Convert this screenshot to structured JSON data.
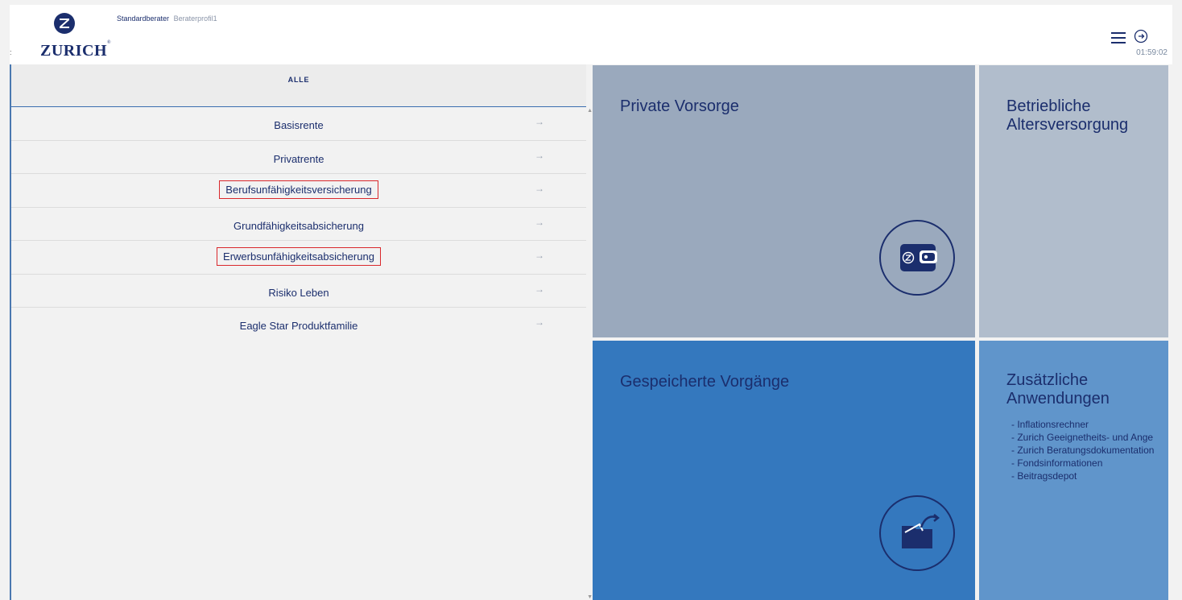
{
  "header": {
    "brand": "ZURICH",
    "role": "Standardberater",
    "profile": "Beraterprofil1",
    "timer": "01:59:02",
    "left_marker": ":"
  },
  "panel": {
    "title": "ALLE",
    "products": [
      {
        "label": "Basisrente",
        "highlighted": false
      },
      {
        "label": "Privatrente",
        "highlighted": false
      },
      {
        "label": "Berufsunfähigkeitsversicherung",
        "highlighted": true
      },
      {
        "label": "Grundfähigkeitsabsicherung",
        "highlighted": false
      },
      {
        "label": "Erwerbsunfähigkeitsabsicherung",
        "highlighted": true
      },
      {
        "label": "Risiko Leben",
        "highlighted": false
      },
      {
        "label": "Eagle Star Produktfamilie",
        "highlighted": false
      }
    ],
    "arrow_glyph": "→"
  },
  "tiles": {
    "private": {
      "title": "Private Vorsorge",
      "icon": "wallet-icon"
    },
    "bav": {
      "title_line1": "Betriebliche",
      "title_line2": "Altersversorgung"
    },
    "saved": {
      "title": "Gespeicherte Vorgänge",
      "icon": "folder-icon"
    },
    "extra": {
      "title_line1": "Zusätzliche",
      "title_line2": "Anwendungen",
      "items": [
        "- Inflationsrechner",
        "- Zurich Geeignetheits- und Ange",
        "- Zurich Beratungsdokumentation",
        "- Fondsinformationen",
        "- Beitragsdepot"
      ]
    }
  },
  "colors": {
    "brand_navy": "#1b2e6d",
    "tile_private": "#9aa9bd",
    "tile_bav": "#b1bdcc",
    "tile_saved": "#3478be",
    "tile_extra": "#6095cb",
    "highlight_red": "#d9282c"
  }
}
